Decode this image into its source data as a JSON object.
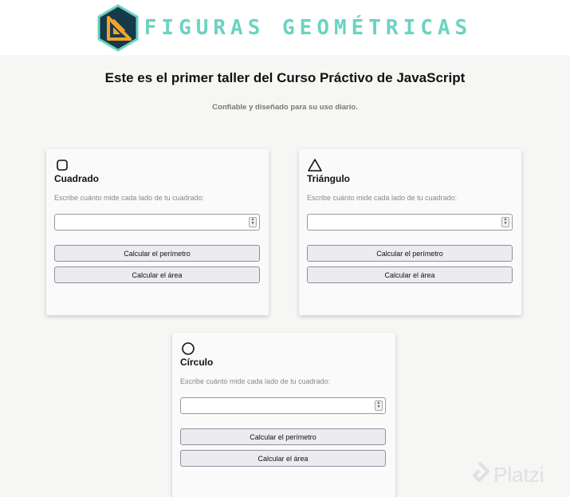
{
  "header": {
    "logo_text": "FIGURAS GEOMÉTRICAS",
    "logo_icon": "ruler-triangle-icon",
    "colors": {
      "logo_text": "#6bd3c1",
      "hex_fill": "#163a4a",
      "hex_stroke": "#6bd3c1",
      "icon_orange": "#f4a428"
    }
  },
  "main": {
    "title": "Este es el primer taller del Curso Práctivo de JavaScript",
    "subtitle": "Confiable y diseñado para su uso diario."
  },
  "cards": [
    {
      "icon": "square-icon",
      "title": "Cuadrado",
      "description": "Escribe cuánto mide cada lado de tu cuadrado:",
      "input_value": "",
      "perimeter_button": "Calcular el perímetro",
      "area_button": "Calcular el área"
    },
    {
      "icon": "triangle-icon",
      "title": "Triángulo",
      "description": "Escribe cuánto mide cada lado de tu cuadrado:",
      "input_value": "",
      "perimeter_button": "Calcular el perímetro",
      "area_button": "Calcular el área"
    },
    {
      "icon": "circle-icon",
      "title": "Círculo",
      "description": "Escribe cuánto mide cada lado de tu cuadrado:",
      "input_value": "",
      "perimeter_button": "Calcular el perímetro",
      "area_button": "Calcular el área"
    }
  ],
  "watermark": {
    "text": "Platzi",
    "icon": "platzi-logo-icon"
  }
}
